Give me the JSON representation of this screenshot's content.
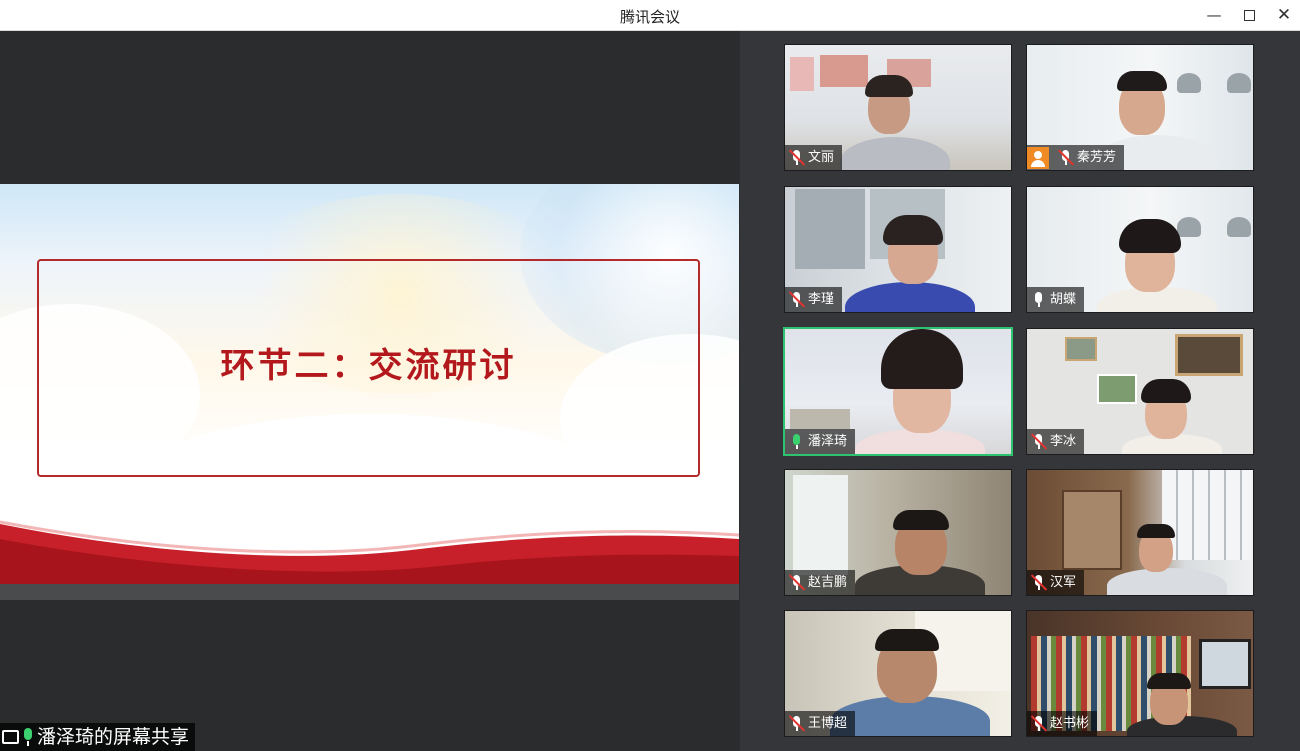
{
  "window": {
    "title": "腾讯会议",
    "minimize_glyph": "—",
    "close_glyph": "✕"
  },
  "slide": {
    "headline": "环节二：交流研讨"
  },
  "share_banner": {
    "text": "潘泽琦的屏幕共享"
  },
  "participants": [
    {
      "name": "文丽",
      "mic": "muted",
      "avatar": false,
      "active": false
    },
    {
      "name": "秦芳芳",
      "mic": "muted",
      "avatar": true,
      "active": false
    },
    {
      "name": "李瑾",
      "mic": "muted",
      "avatar": false,
      "active": false
    },
    {
      "name": "胡蝶",
      "mic": "on",
      "avatar": false,
      "active": false
    },
    {
      "name": "潘泽琦",
      "mic": "speaking",
      "avatar": false,
      "active": true
    },
    {
      "name": "李冰",
      "mic": "muted",
      "avatar": false,
      "active": false
    },
    {
      "name": "赵吉鹏",
      "mic": "muted",
      "avatar": false,
      "active": false
    },
    {
      "name": "汉军",
      "mic": "muted",
      "avatar": false,
      "active": false
    },
    {
      "name": "王博超",
      "mic": "muted",
      "avatar": false,
      "active": false
    },
    {
      "name": "赵书彬",
      "mic": "muted",
      "avatar": false,
      "active": false
    }
  ],
  "colors": {
    "accent_speaking": "#2ec46f",
    "mute_red": "#e5322e",
    "slide_title_red": "#b3191c",
    "avatar_orange": "#f08a24"
  }
}
